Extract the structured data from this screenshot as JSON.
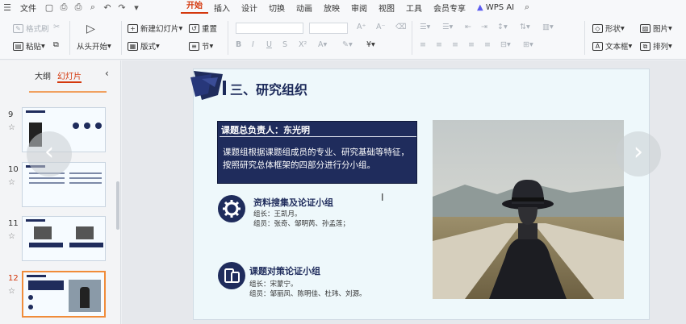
{
  "menubar": {
    "file": "文件",
    "tabs": [
      "开始",
      "插入",
      "设计",
      "切换",
      "动画",
      "放映",
      "审阅",
      "视图",
      "工具",
      "会员专享"
    ],
    "active_tab": "开始",
    "wps_ai": "WPS AI"
  },
  "ribbon": {
    "format_painter": "格式刷",
    "paste": "粘贴",
    "play_from_start": "从头开始",
    "new_slide": "新建幻灯片",
    "layout": "版式",
    "reset": "重置",
    "section": "节",
    "shape": "形状",
    "picture": "图片",
    "textbox": "文本框",
    "arrange": "排列"
  },
  "panel": {
    "tab_outline": "大纲",
    "tab_slides": "幻灯片",
    "slides": [
      {
        "num": "9"
      },
      {
        "num": "10"
      },
      {
        "num": "11"
      },
      {
        "num": "12"
      }
    ]
  },
  "slide": {
    "title": "三、研究组织",
    "lead_title": "课题总负责人：东光明",
    "lead_text": "课题组根据课题组成员的专业、研究基础等特征，按照研究总体框架的四部分进行分小组。",
    "group1": {
      "title": "资料搜集及论证小组",
      "leader": "组长：王凯月。",
      "members": "组员：张奇、邹明芮、孙孟莲；"
    },
    "group2": {
      "title": "课题对策论证小组",
      "leader": "组长：宋蒙宁。",
      "members": "组员：邹丽凤、陈明佳、杜玮、刘源。"
    }
  },
  "colors": {
    "accent": "#d4380d",
    "navy": "#1f2c5c",
    "slide_bg": "#eef8fb"
  }
}
